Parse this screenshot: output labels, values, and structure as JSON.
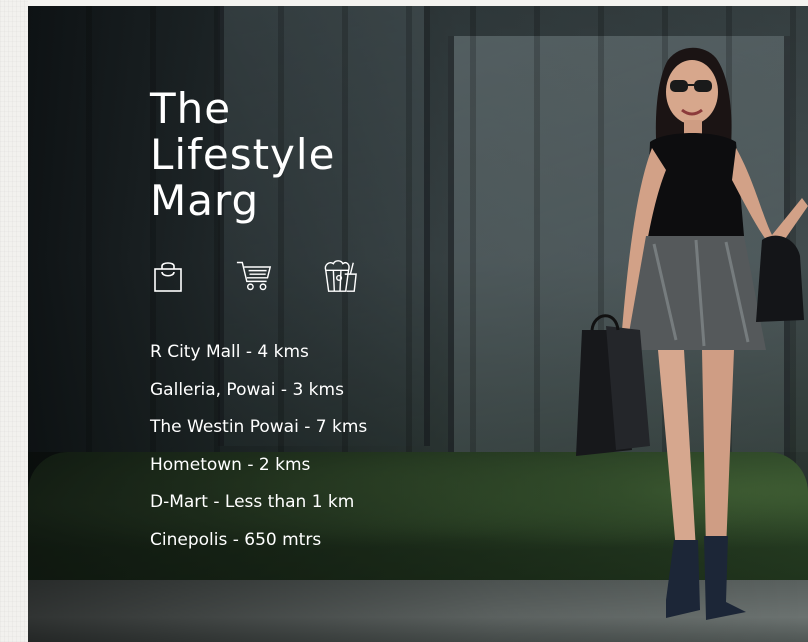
{
  "hero": {
    "title_lines": [
      "The",
      "Lifestyle",
      "Marg"
    ]
  },
  "icons": [
    {
      "name": "shopping-bag-icon"
    },
    {
      "name": "shopping-cart-icon"
    },
    {
      "name": "popcorn-cinema-icon"
    }
  ],
  "places": [
    "R City Mall - 4 kms",
    "Galleria, Powai - 3 kms",
    "The Westin Powai - 7 kms",
    "Hometown - 2 kms",
    "D-Mart - Less than 1 km",
    "Cinepolis - 650 mtrs"
  ],
  "colors": {
    "text": "#ffffff",
    "page_background": "#f4f3f0",
    "photo_shadow": "#0a0e10"
  }
}
